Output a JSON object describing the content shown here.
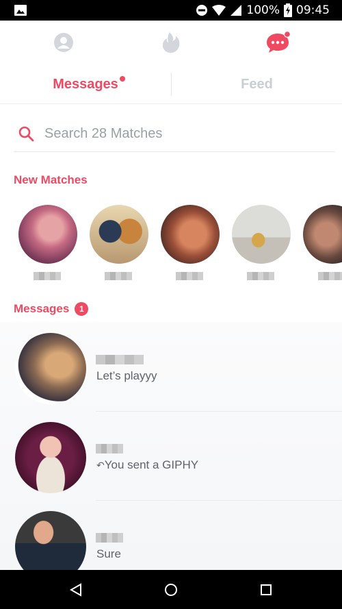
{
  "status_bar": {
    "battery": "100%",
    "time": "09:45"
  },
  "tabs": {
    "messages": "Messages",
    "feed": "Feed"
  },
  "search": {
    "placeholder": "Search 28 Matches"
  },
  "new_matches": {
    "title": "New Matches"
  },
  "messages_section": {
    "title": "Messages",
    "badge": "1",
    "items": [
      {
        "preview": "Let’s playyy"
      },
      {
        "preview": "You sent a GIPHY"
      },
      {
        "preview": "Sure"
      }
    ]
  },
  "colors": {
    "accent": "#ef4a62",
    "inactive": "#c9ced4"
  },
  "icons": {
    "nav_profile": "profile-icon",
    "nav_home": "flame-icon",
    "nav_messages": "chat-bubble-icon",
    "search": "search-icon",
    "reply": "reply-arrow-icon"
  }
}
